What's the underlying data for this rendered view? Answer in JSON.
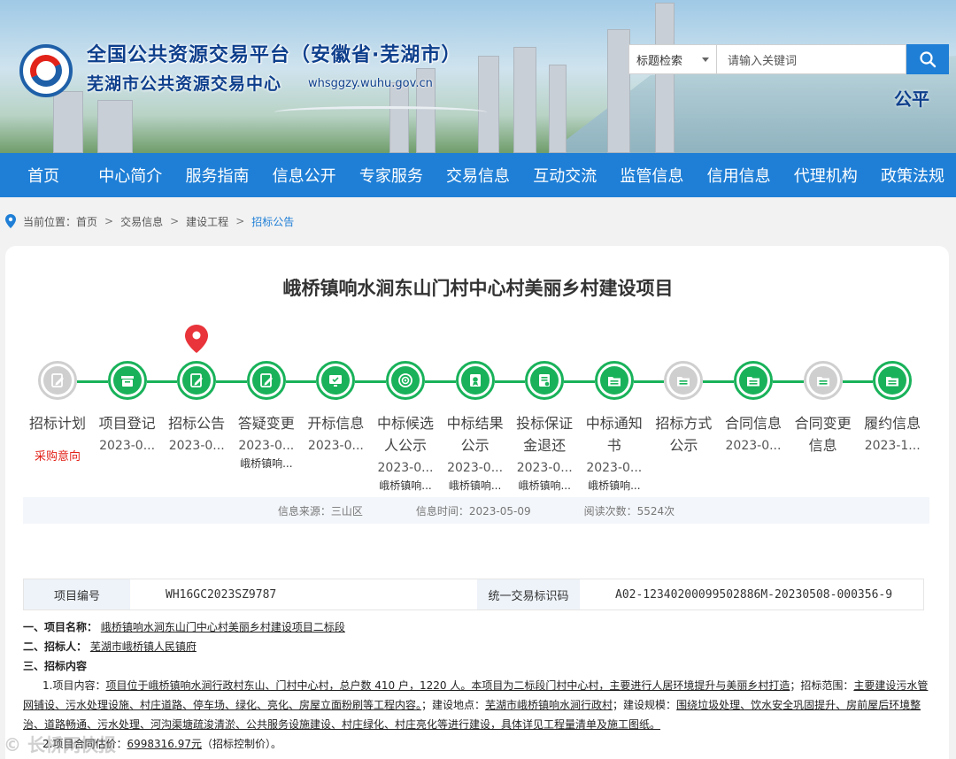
{
  "header": {
    "title_line1": "全国公共资源交易平台（安徽省·芜湖市）",
    "title_line2": "芜湖市公共资源交易中心",
    "url": "whsggzy.wuhu.gov.cn",
    "slogan": "公平",
    "search": {
      "select_value": "标题检索",
      "placeholder": "请输入关键词"
    }
  },
  "nav": [
    "首页",
    "中心简介",
    "服务指南",
    "信息公开",
    "专家服务",
    "交易信息",
    "互动交流",
    "监管信息",
    "信用信息",
    "代理机构",
    "政策法规"
  ],
  "breadcrumb": {
    "label": "当前位置：",
    "items": [
      "首页",
      "交易信息",
      "建设工程"
    ],
    "current": "招标公告"
  },
  "project": {
    "title": "峨桥镇响水涧东山门村中心村美丽乡村建设项目"
  },
  "steps": [
    {
      "label": "招标计划",
      "date": "",
      "sub": "",
      "extra": "采购意向",
      "status": "inactive",
      "icon": "edit-doc-icon"
    },
    {
      "label": "项目登记",
      "date": "2023-0...",
      "sub": "",
      "status": "active",
      "icon": "box-icon"
    },
    {
      "label": "招标公告",
      "date": "2023-0...",
      "sub": "",
      "status": "active",
      "current": true,
      "icon": "edit-doc-icon"
    },
    {
      "label": "答疑变更",
      "date": "2023-0...",
      "sub": "峨桥镇响...",
      "status": "active",
      "icon": "edit-doc-icon"
    },
    {
      "label": "开标信息",
      "date": "2023-0...",
      "sub": "",
      "status": "active",
      "icon": "screen-icon"
    },
    {
      "label": "中标候选人公示",
      "date": "2023-0...",
      "sub": "峨桥镇响...",
      "status": "active",
      "icon": "target-icon"
    },
    {
      "label": "中标结果公示",
      "date": "2023-0...",
      "sub": "峨桥镇响...",
      "status": "active",
      "icon": "award-doc-icon"
    },
    {
      "label": "投标保证金退还",
      "date": "2023-0...",
      "sub": "峨桥镇响...",
      "status": "active",
      "icon": "money-doc-icon"
    },
    {
      "label": "中标通知书",
      "date": "2023-0...",
      "sub": "峨桥镇响...",
      "status": "active",
      "icon": "folder-icon"
    },
    {
      "label": "招标方式公示",
      "date": "",
      "sub": "",
      "status": "inactive",
      "icon": "folder-icon"
    },
    {
      "label": "合同信息",
      "date": "2023-0...",
      "sub": "",
      "status": "active",
      "icon": "folder-icon"
    },
    {
      "label": "合同变更信息",
      "date": "",
      "sub": "",
      "status": "inactive",
      "icon": "folder-icon"
    },
    {
      "label": "履约信息",
      "date": "2023-1...",
      "sub": "",
      "status": "active",
      "icon": "folder-icon"
    }
  ],
  "info": {
    "source": "信息来源：三山区",
    "time": "信息时间：2023-05-09",
    "views": "阅读次数：5524次"
  },
  "table": {
    "k1": "项目编号",
    "v1": "WH16GC2023SZ9787",
    "k2": "统一交易标识码",
    "v2": "A02-12340200099502886M-20230508-000356-9"
  },
  "doc": {
    "s1_label": "一、项目名称：",
    "s1_value": "峨桥镇响水涧东山门中心村美丽乡村建设项目二标段",
    "s2_label": "二、招标人：",
    "s2_value": "芜湖市峨桥镇人民镇府",
    "s3_label": "三、招标内容",
    "p1_prefix": "1.项目内容：",
    "p1_value": "项目位于峨桥镇响水涧行政村东山、门村中心村，总户数 410 户，1220 人。本项目为二标段门村中心村，主要进行人居环境提升与美丽乡村打造",
    "p1_scope_label": "；招标范围：",
    "p1_scope_value": "主要建设污水管网铺设、污水处理设施、村庄道路、停车场、绿化、亮化、房屋立面粉刷等工程内容。",
    "p1_place_label": "；建设地点：",
    "p1_place_value": "芜湖市峨桥镇响水涧行政村",
    "p1_size_label": "；建设规模：",
    "p1_size_value": "围绕垃圾处理、饮水安全巩固提升、房前屋后环境整治、道路畅通、污水处理、河沟渠塘疏浚清淤、公共服务设施建设、村庄绿化、村庄亮化等进行建设，具体详见工程量清单及施工图纸。",
    "p2_prefix": "2.项目合同估价：",
    "p2_value": "6998316.97元",
    "p2_suffix": "（招标控制价）。"
  },
  "watermark": "© 长桥网快报"
}
